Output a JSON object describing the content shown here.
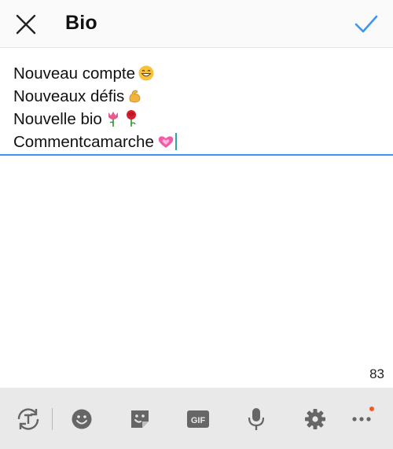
{
  "header": {
    "title": "Bio",
    "close_icon": "close-icon",
    "done_icon": "check-icon",
    "accent_color": "#3897f0"
  },
  "editor": {
    "lines": [
      {
        "text": "Nouveau compte",
        "emoji": "grinning-face-emoji"
      },
      {
        "text": "Nouveaux défis",
        "emoji": "flexed-biceps-emoji"
      },
      {
        "text": "Nouvelle bio",
        "emoji": "tulip-rose-emoji"
      },
      {
        "text": "Commentcamarche",
        "emoji": "growing-heart-emoji"
      }
    ]
  },
  "counter": "83",
  "keyboard_toolbar": {
    "items": [
      {
        "icon": "text-cycle-icon"
      },
      {
        "icon": "smiley-icon"
      },
      {
        "icon": "sticker-icon"
      },
      {
        "icon": "gif-icon",
        "label": "GIF"
      },
      {
        "icon": "microphone-icon"
      },
      {
        "icon": "gear-icon"
      },
      {
        "icon": "more-icon"
      }
    ]
  }
}
